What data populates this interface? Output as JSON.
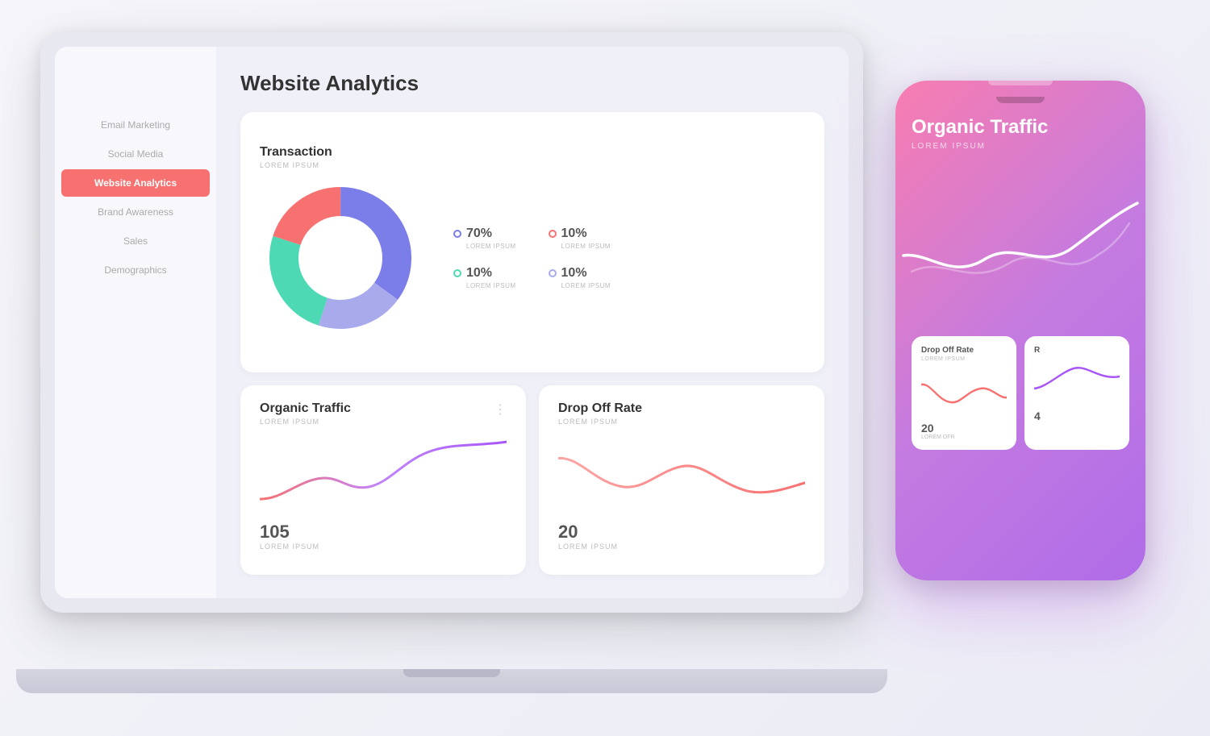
{
  "page": {
    "background": "#f0f0f5"
  },
  "sidebar": {
    "items": [
      {
        "label": "Email Marketing",
        "active": false
      },
      {
        "label": "Social Media",
        "active": false
      },
      {
        "label": "Website Analytics",
        "active": true
      },
      {
        "label": "Brand Awareness",
        "active": false
      },
      {
        "label": "Sales",
        "active": false
      },
      {
        "label": "Demographics",
        "active": false
      }
    ]
  },
  "main": {
    "page_title": "Website Analytics",
    "transaction_card": {
      "title": "Transaction",
      "subtitle": "LOREM IPSUM",
      "donut": {
        "segments": [
          {
            "color": "#6c6ce8",
            "percent": 35,
            "label": "70%",
            "sub": "LOREM IPSUM",
            "dot_color": "#6c6ce8"
          },
          {
            "color": "#9ca0e0",
            "percent": 20,
            "label": "10%",
            "sub": "LOREM IPSUM",
            "dot_color": "#f87171"
          },
          {
            "color": "#4dd9b4",
            "percent": 25,
            "label": "10%",
            "sub": "LOREM IPSUM",
            "dot_color": "#4dd9b4"
          },
          {
            "color": "#f87171",
            "percent": 20,
            "label": "10%",
            "sub": "LOREM IPSUM",
            "dot_color": "#9ca0e0"
          }
        ]
      }
    },
    "organic_traffic_card": {
      "title": "Organic Traffic",
      "subtitle": "LOREM IPSUM",
      "value": "105",
      "value_label": "LOREM IPSUM"
    },
    "drop_off_card": {
      "title": "Drop Off Rate",
      "subtitle": "LOREM IPSUM",
      "value": "20",
      "value_label": "LOREM IPSUM"
    }
  },
  "phone": {
    "title": "Organic Traffic",
    "subtitle": "LOREM IPSUM",
    "mini_cards": [
      {
        "title": "Drop Off Rate",
        "subtitle": "LOREM IPSUM",
        "value": "20",
        "value_label": "LOREM OFR"
      },
      {
        "title": "R",
        "subtitle": "",
        "value": "4",
        "value_label": ""
      }
    ]
  }
}
